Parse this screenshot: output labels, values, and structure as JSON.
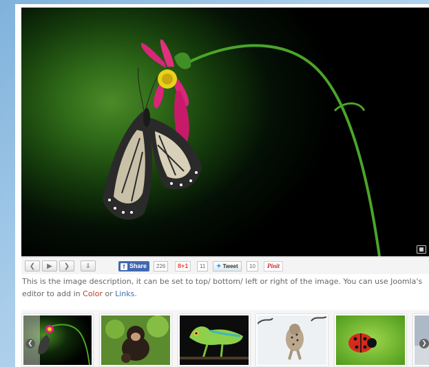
{
  "toolbar": {
    "prev_icon": "arrow-left-icon",
    "play_icon": "play-icon",
    "next_icon": "arrow-right-icon",
    "download_icon": "download-icon",
    "facebook": {
      "label": "Share",
      "count": "226"
    },
    "gplus": {
      "label": "8+1",
      "count": "11"
    },
    "twitter": {
      "label": "Tweet",
      "count": "10"
    },
    "pinterest": {
      "label": "Pinit"
    }
  },
  "description": {
    "text1": "This is the image description, it can be set to top/ bottom/ left or right of the image. You can use Joomla's editor to add in ",
    "color_link": "Color",
    "or": " or ",
    "links_link": "Links",
    "end": "."
  },
  "thumbnails": [
    {
      "subject": "butterfly on flower"
    },
    {
      "subject": "chimpanzee"
    },
    {
      "subject": "chameleon"
    },
    {
      "subject": "snow leopard"
    },
    {
      "subject": "ladybug"
    },
    {
      "subject": "partial next image"
    }
  ],
  "colors": {
    "link_color": "#c0392b",
    "link_blue": "#3a6fb0",
    "facebook": "#4267b2",
    "twitter": "#1da1f2",
    "pinterest": "#cb2027"
  }
}
